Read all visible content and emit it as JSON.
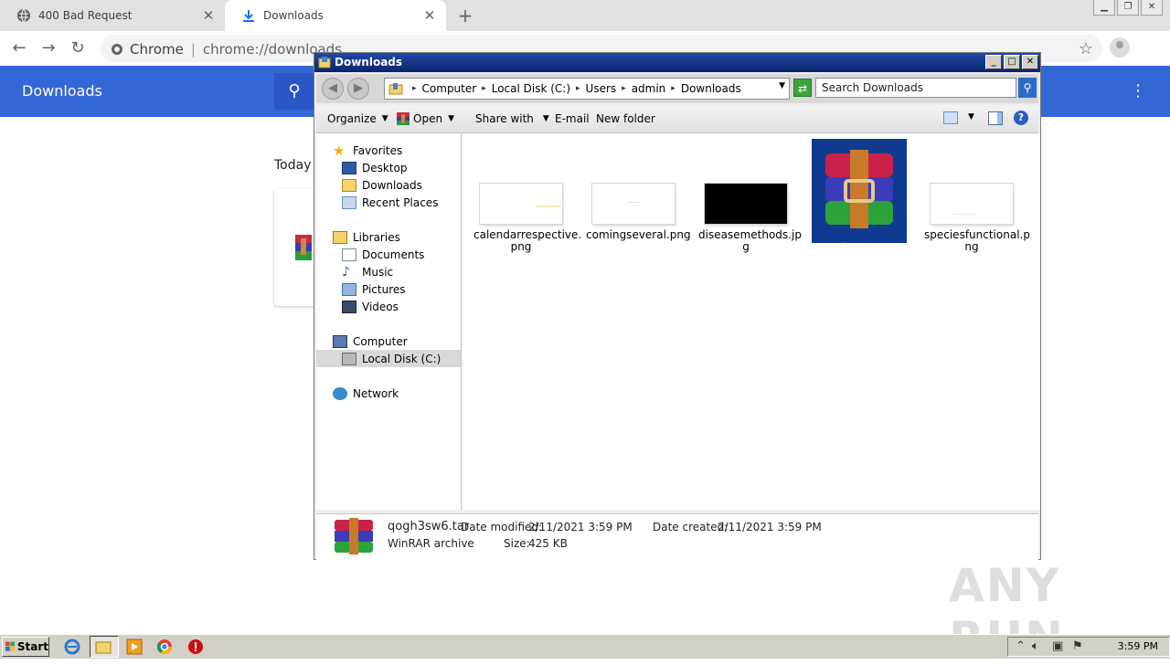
{
  "browser": {
    "tabs": [
      {
        "label": "400 Bad Request",
        "icon": "globe-icon"
      },
      {
        "label": "Downloads",
        "icon": "download-icon",
        "active": true
      }
    ],
    "omnibox": {
      "site": "Chrome",
      "url": "chrome://downloads"
    },
    "window_controls": [
      "minimize",
      "restore",
      "close"
    ]
  },
  "downloads_page": {
    "title": "Downloads",
    "section_label": "Today",
    "accent_color": "#3367d6"
  },
  "explorer": {
    "title": "Downloads",
    "breadcrumb": [
      "Computer",
      "Local Disk (C:)",
      "Users",
      "admin",
      "Downloads"
    ],
    "search_placeholder": "Search Downloads",
    "commands": {
      "organize": "Organize",
      "open": "Open",
      "share_with": "Share with",
      "email": "E-mail",
      "new_folder": "New folder"
    },
    "nav": {
      "favorites": "Favorites",
      "desktop": "Desktop",
      "downloads": "Downloads",
      "recent_places": "Recent Places",
      "libraries": "Libraries",
      "documents": "Documents",
      "music": "Music",
      "pictures": "Pictures",
      "videos": "Videos",
      "computer": "Computer",
      "local_disk": "Local Disk (C:)",
      "network": "Network"
    },
    "files": [
      {
        "name": "calendarrespective.png",
        "line1": "calendarrespective.",
        "line2": "png",
        "thumb": "white"
      },
      {
        "name": "comingseveral.png",
        "line1": "comingseveral.png",
        "line2": "",
        "thumb": "white"
      },
      {
        "name": "diseasemethods.jpg",
        "line1": "diseasemethods.jp",
        "line2": "g",
        "thumb": "black"
      },
      {
        "name": "qogh3sw6.tar",
        "line1": "qogh3sw6.tar",
        "line2": "",
        "thumb": "winrar",
        "selected": true
      },
      {
        "name": "speciesfunctional.png",
        "line1": "speciesfunctional.p",
        "line2": "ng",
        "thumb": "white"
      }
    ],
    "details": {
      "name": "qogh3sw6.tar",
      "type": "WinRAR archive",
      "date_modified_label": "Date modified:",
      "date_modified": "2/11/2021 3:59 PM",
      "date_created_label": "Date created:",
      "date_created": "2/11/2021 3:59 PM",
      "size_label": "Size:",
      "size": "425 KB"
    }
  },
  "taskbar": {
    "start_label": "Start",
    "clock": "3:59 PM"
  },
  "watermark": "ANY RUN"
}
